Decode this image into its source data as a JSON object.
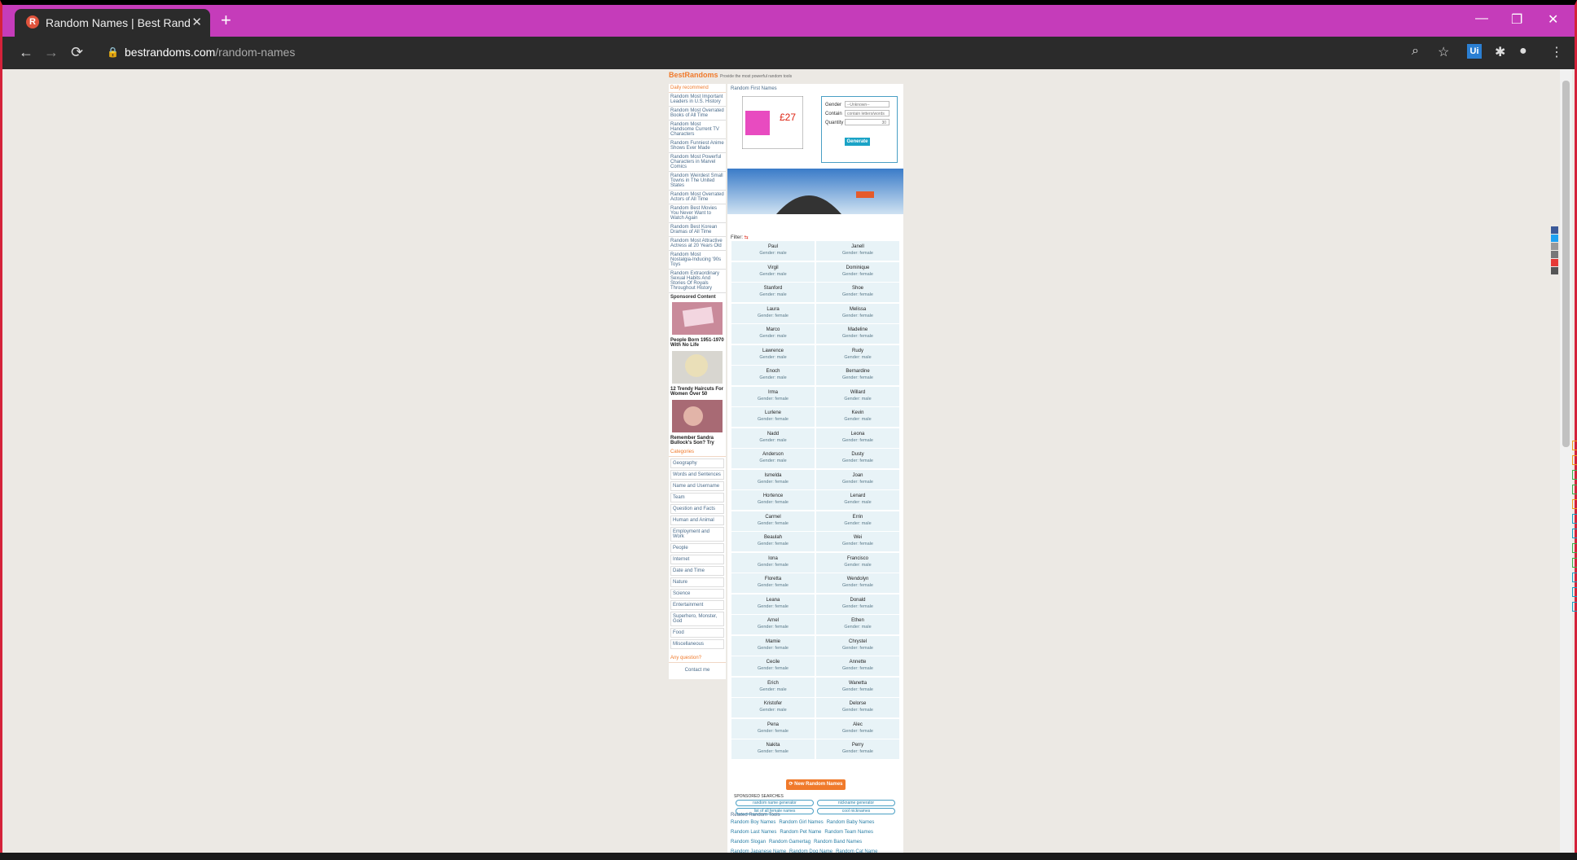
{
  "browser": {
    "tab_title": "Random Names | Best Random T...",
    "favicon_letter": "R",
    "close_tab": "✕",
    "new_tab": "+",
    "url_domain": "bestrandoms.com",
    "url_path": "/random-names",
    "controls": {
      "minimize": "—",
      "restore": "❐",
      "close": "✕"
    },
    "ext_badge": "Ui"
  },
  "site": {
    "brand": "BestRandoms",
    "tagline": "Provide the most powerful random tools",
    "daily_header": "Daily recommend",
    "daily_items": [
      "Random Most Important Leaders in U.S. History",
      "Random Most Overrated Books of All Time",
      "Random Most Handsome Current TV Characters",
      "Random Funniest Anime Shows Ever Made",
      "Random Most Powerful Characters in Marvel Comics",
      "Random Weirdest Small Towns in The United States",
      "Random Most Overrated Actors of All Time",
      "Random Best Movies You Never Want to Watch Again",
      "Random Best Korean Dramas of All Time",
      "Random Most Attractive Actress at 20 Years Old",
      "Random Most Nostalgia-Inducing '90s Toys",
      "Random Extraordinary Sexual Habits And Stories Of Royals Throughout History"
    ],
    "sponsored_header": "Sponsored Content",
    "sponsored": [
      {
        "title": "People Born 1951-1970 With No Life"
      },
      {
        "title": "12 Trendy Haircuts For Women Over 50"
      },
      {
        "title": "Remember Sandra Bullock's Son? Try"
      }
    ],
    "categories_header": "Categories",
    "categories": [
      "Geography",
      "Words and Sentences",
      "Name and Username",
      "Team",
      "Question and Facts",
      "Human and Animal",
      "Employment and Work",
      "People",
      "Internet",
      "Date and Time",
      "Nature",
      "Science",
      "Entertainment",
      "Superhero, Monster, God",
      "Food",
      "Miscellaneous"
    ],
    "question_header": "Any question?",
    "contact": "Contact me",
    "breadcrumb": "Random First Names",
    "form": {
      "gender_label": "Gender",
      "gender_value": "--Unknown--",
      "contain_label": "Contain",
      "contain_placeholder": "contain letters/words",
      "quantity_label": "Quantity",
      "quantity_value": "30",
      "generate": "Generate"
    },
    "ad_price": "£27",
    "filter_label": "Filter:",
    "names": [
      {
        "name": "Paul",
        "gender": "Gender: male"
      },
      {
        "name": "Janell",
        "gender": "Gender: female"
      },
      {
        "name": "Virgil",
        "gender": "Gender: male"
      },
      {
        "name": "Dominique",
        "gender": "Gender: female"
      },
      {
        "name": "Stanford",
        "gender": "Gender: male"
      },
      {
        "name": "Shoe",
        "gender": "Gender: female"
      },
      {
        "name": "Laura",
        "gender": "Gender: female"
      },
      {
        "name": "Melissa",
        "gender": "Gender: female"
      },
      {
        "name": "Marco",
        "gender": "Gender: male"
      },
      {
        "name": "Madeline",
        "gender": "Gender: female"
      },
      {
        "name": "Lawrence",
        "gender": "Gender: male"
      },
      {
        "name": "Rudy",
        "gender": "Gender: male"
      },
      {
        "name": "Enoch",
        "gender": "Gender: male"
      },
      {
        "name": "Bernardine",
        "gender": "Gender: female"
      },
      {
        "name": "Irma",
        "gender": "Gender: female"
      },
      {
        "name": "Willard",
        "gender": "Gender: male"
      },
      {
        "name": "Lurlene",
        "gender": "Gender: female"
      },
      {
        "name": "Kevin",
        "gender": "Gender: male"
      },
      {
        "name": "Nadd",
        "gender": "Gender: male"
      },
      {
        "name": "Leona",
        "gender": "Gender: female"
      },
      {
        "name": "Anderson",
        "gender": "Gender: male"
      },
      {
        "name": "Dusty",
        "gender": "Gender: female"
      },
      {
        "name": "Ismelda",
        "gender": "Gender: female"
      },
      {
        "name": "Joan",
        "gender": "Gender: female"
      },
      {
        "name": "Hortence",
        "gender": "Gender: female"
      },
      {
        "name": "Lenard",
        "gender": "Gender: male"
      },
      {
        "name": "Carmel",
        "gender": "Gender: female"
      },
      {
        "name": "Errin",
        "gender": "Gender: male"
      },
      {
        "name": "Beaulah",
        "gender": "Gender: female"
      },
      {
        "name": "Wei",
        "gender": "Gender: female"
      },
      {
        "name": "Iona",
        "gender": "Gender: female"
      },
      {
        "name": "Francisco",
        "gender": "Gender: male"
      },
      {
        "name": "Floretta",
        "gender": "Gender: female"
      },
      {
        "name": "Wendolyn",
        "gender": "Gender: female"
      },
      {
        "name": "Leana",
        "gender": "Gender: female"
      },
      {
        "name": "Donald",
        "gender": "Gender: female"
      },
      {
        "name": "Arnel",
        "gender": "Gender: female"
      },
      {
        "name": "Ethen",
        "gender": "Gender: male"
      },
      {
        "name": "Mamie",
        "gender": "Gender: female"
      },
      {
        "name": "Chrystel",
        "gender": "Gender: female"
      },
      {
        "name": "Cecile",
        "gender": "Gender: female"
      },
      {
        "name": "Annette",
        "gender": "Gender: female"
      },
      {
        "name": "Erich",
        "gender": "Gender: male"
      },
      {
        "name": "Wanetta",
        "gender": "Gender: female"
      },
      {
        "name": "Kristofer",
        "gender": "Gender: male"
      },
      {
        "name": "Delorse",
        "gender": "Gender: female"
      },
      {
        "name": "Pena",
        "gender": "Gender: female"
      },
      {
        "name": "Alec",
        "gender": "Gender: female"
      },
      {
        "name": "Nakita",
        "gender": "Gender: female"
      },
      {
        "name": "Perry",
        "gender": "Gender: female"
      }
    ],
    "new_names_button": "New Random Names",
    "sponsored_searches": "SPONSORED SEARCHES",
    "sponsor_pills": [
      "random name generator",
      "nickname generator",
      "list of all female names",
      "cool nicknames"
    ],
    "related_header": "Related Random Tools",
    "related": [
      "Random Boy Names",
      "Random Girl Names",
      "Random Baby Names",
      "Random Last Names",
      "Random Pet Name",
      "Random Team Names",
      "Random Slogan",
      "Random Gamertag",
      "Random Band Names",
      "Random Japanese Name",
      "Random Dog Name",
      "Random Cat Name"
    ]
  }
}
